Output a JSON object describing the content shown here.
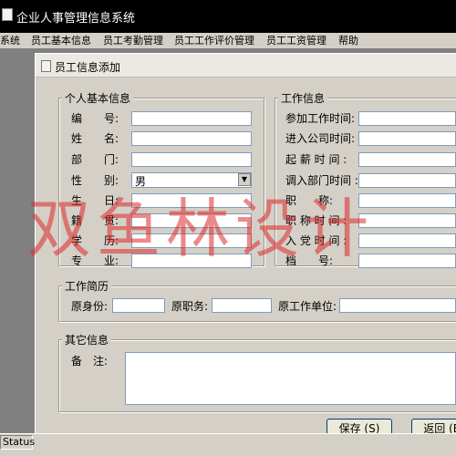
{
  "app": {
    "title": "企业人事管理信息系统",
    "menu": [
      "系统",
      "员工基本信息",
      "员工考勤管理",
      "员工工作评价管理",
      "员工工资管理",
      "帮助"
    ],
    "status": "Status"
  },
  "window": {
    "title": "员工信息添加"
  },
  "personal": {
    "title": "个人基本信息",
    "labels": [
      "编　　号:",
      "姓　　名:",
      "部　　门:",
      "性　　别:",
      "生　　日:",
      "籍　　贯:",
      "学　　历:",
      "专　　业:"
    ],
    "gender_value": "男"
  },
  "work": {
    "title": "工作信息",
    "labels": [
      "参加工作时间:",
      "进入公司时间:",
      "起 薪 时 间 :",
      "调入部门时间 :",
      "职　　称:",
      "职 称 时 间 :",
      "入 党 时 间 :",
      "档　　号:"
    ]
  },
  "resume": {
    "title": "工作简历",
    "labels": [
      "原身份:",
      "原职务:",
      "原工作单位:"
    ]
  },
  "other": {
    "title": "其它信息",
    "remark_label": "备　注:"
  },
  "buttons": {
    "save": "保存 (S)",
    "back": "返回 (B)"
  },
  "watermark": "双鱼林设计"
}
